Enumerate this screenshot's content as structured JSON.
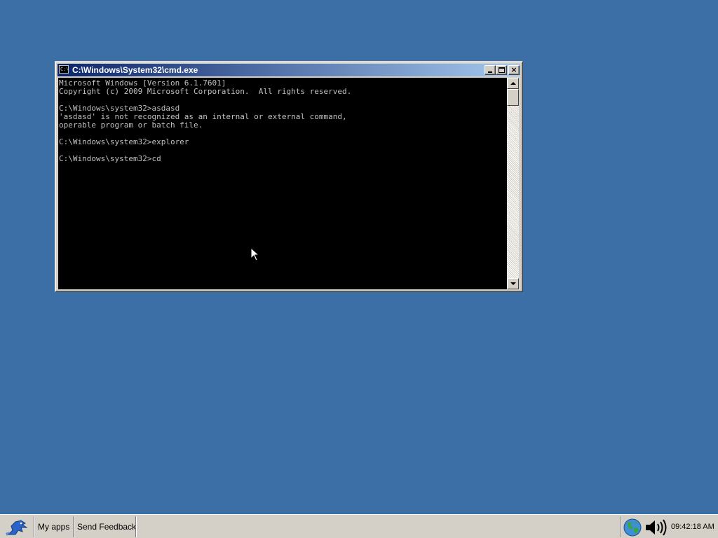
{
  "desktop": {
    "background_color": "#3b6fa6"
  },
  "window": {
    "title": "C:\\Windows\\System32\\cmd.exe",
    "icon_text": "C:\\",
    "title_colors": [
      "#0a246a",
      "#a6caf0"
    ],
    "icons": {
      "minimize": "minimize-icon",
      "maximize": "maximize-icon",
      "close": "close-icon"
    },
    "close_glyph": "×",
    "console_text": "Microsoft Windows [Version 6.1.7601]\nCopyright (c) 2009 Microsoft Corporation.  All rights reserved.\n\nC:\\Windows\\system32>asdasd\n'asdasd' is not recognized as an internal or external command,\noperable program or batch file.\n\nC:\\Windows\\system32>explorer\n\nC:\\Windows\\system32>cd"
  },
  "taskbar": {
    "start_icon": "bird-logo-icon",
    "items": [
      "My apps",
      "Send Feedback",
      ""
    ],
    "tray_icons": [
      "globe-icon",
      "speaker-icon"
    ],
    "clock": "09:42:18 AM"
  }
}
